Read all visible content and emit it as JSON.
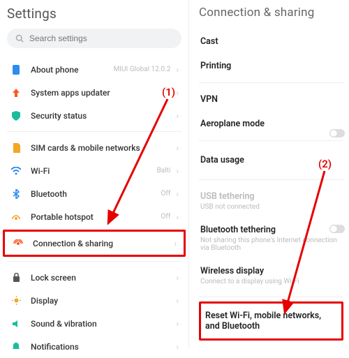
{
  "left": {
    "title": "Settings",
    "search_placeholder": "Search settings",
    "groups": [
      [
        {
          "icon": "phone-icon",
          "color": "#2d8cf0",
          "label": "About phone",
          "value": "MIUI Global 12.0.2"
        },
        {
          "icon": "upgrade-icon",
          "color": "#ff5722",
          "label": "System apps updater",
          "value": ""
        },
        {
          "icon": "shield-icon",
          "color": "#1abc9c",
          "label": "Security status",
          "value": ""
        }
      ],
      [
        {
          "icon": "sim-icon",
          "color": "#f5a623",
          "label": "SIM cards & mobile networks",
          "value": ""
        },
        {
          "icon": "wifi-icon",
          "color": "#2d8cf0",
          "label": "Wi-Fi",
          "value": "Balti"
        },
        {
          "icon": "bluetooth-icon",
          "color": "#2d8cf0",
          "label": "Bluetooth",
          "value": "Off"
        },
        {
          "icon": "hotspot-icon",
          "color": "#f5a623",
          "label": "Portable hotspot",
          "value": "Off"
        },
        {
          "icon": "share-icon",
          "color": "#ff5722",
          "label": "Connection & sharing",
          "value": "",
          "highlight": true
        }
      ],
      [
        {
          "icon": "lock-icon",
          "color": "#555",
          "label": "Lock screen",
          "value": ""
        },
        {
          "icon": "display-icon",
          "color": "#f5a623",
          "label": "Display",
          "value": ""
        },
        {
          "icon": "sound-icon",
          "color": "#1abc9c",
          "label": "Sound & vibration",
          "value": ""
        },
        {
          "icon": "bell-icon",
          "color": "#1abc9c",
          "label": "Notifications",
          "value": ""
        }
      ]
    ]
  },
  "right": {
    "title": "Connection & sharing",
    "sections": [
      [
        {
          "label": "Cast"
        },
        {
          "label": "Printing"
        }
      ],
      [
        {
          "label": "VPN"
        },
        {
          "label": "Aeroplane mode",
          "toggle": true
        }
      ],
      [
        {
          "label": "Data usage"
        }
      ],
      [
        {
          "label": "USB tethering",
          "sub": "USB not connected",
          "muted": true
        },
        {
          "label": "Bluetooth tethering",
          "sub": "Not sharing this phone's Internet connection via Bluetooth",
          "toggle": true
        },
        {
          "label": "Wireless display",
          "sub": "Connect to a display using Wi-Fi"
        }
      ],
      [
        {
          "label": "Reset Wi-Fi, mobile networks, and Bluetooth",
          "highlight": true
        }
      ]
    ]
  },
  "annotations": {
    "one": "(1)",
    "two": "(2)"
  }
}
